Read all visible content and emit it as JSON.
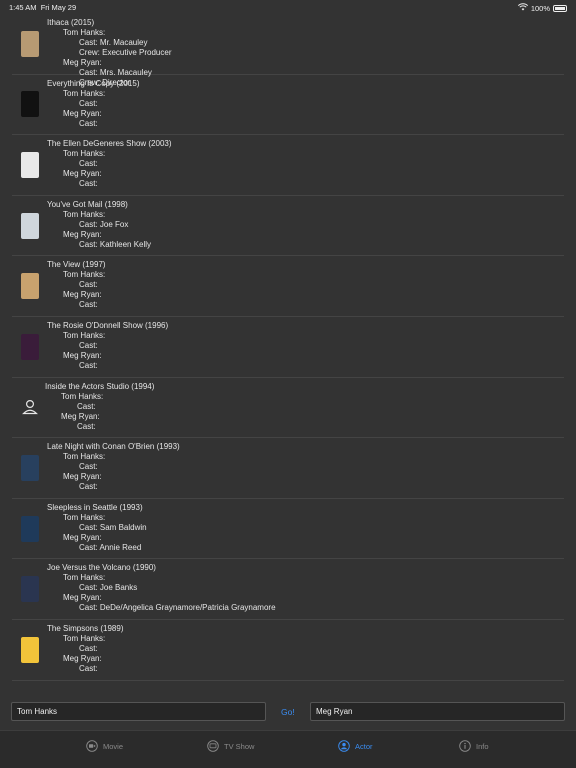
{
  "status": {
    "time": "1:45 AM",
    "date": "Fri May 29",
    "battery": "100%"
  },
  "movies": [
    {
      "title": "Ithaca (2015)",
      "a1": "Tom Hanks:",
      "r1": [
        "Cast: Mr. Macauley",
        "Crew: Executive Producer"
      ],
      "a2": "Meg Ryan:",
      "r2": [
        "Cast: Mrs. Macauley",
        "Crew: Director"
      ],
      "thumb": "#b79a73"
    },
    {
      "title": "Everything Is Copy (2015)",
      "a1": "Tom Hanks:",
      "r1": [
        "Cast:"
      ],
      "a2": "Meg Ryan:",
      "r2": [
        "Cast:"
      ],
      "thumb": "#111111"
    },
    {
      "title": "The Ellen DeGeneres Show (2003)",
      "a1": "Tom Hanks:",
      "r1": [
        "Cast:"
      ],
      "a2": "Meg Ryan:",
      "r2": [
        "Cast:"
      ],
      "thumb": "#e8e8e8"
    },
    {
      "title": "You've Got Mail (1998)",
      "a1": "Tom Hanks:",
      "r1": [
        "Cast: Joe Fox"
      ],
      "a2": "Meg Ryan:",
      "r2": [
        "Cast: Kathleen Kelly"
      ],
      "thumb": "#cfd6dc"
    },
    {
      "title": "The View (1997)",
      "a1": "Tom Hanks:",
      "r1": [
        "Cast:"
      ],
      "a2": "Meg Ryan:",
      "r2": [
        "Cast:"
      ],
      "thumb": "#c8a26e"
    },
    {
      "title": "The Rosie O'Donnell Show (1996)",
      "a1": "Tom Hanks:",
      "r1": [
        "Cast:"
      ],
      "a2": "Meg Ryan:",
      "r2": [
        "Cast:"
      ],
      "thumb": "#3a1c3a"
    },
    {
      "title": "Inside the Actors Studio (1994)",
      "a1": "Tom Hanks:",
      "r1": [
        "Cast:"
      ],
      "a2": "Meg Ryan:",
      "r2": [
        "Cast:"
      ],
      "thumb": "none"
    },
    {
      "title": "Late Night with Conan O'Brien (1993)",
      "a1": "Tom Hanks:",
      "r1": [
        "Cast:"
      ],
      "a2": "Meg Ryan:",
      "r2": [
        "Cast:"
      ],
      "thumb": "#28405e"
    },
    {
      "title": "Sleepless in Seattle (1993)",
      "a1": "Tom Hanks:",
      "r1": [
        "Cast: Sam Baldwin"
      ],
      "a2": "Meg Ryan:",
      "r2": [
        "Cast: Annie Reed"
      ],
      "thumb": "#1f3a5a"
    },
    {
      "title": "Joe Versus the Volcano (1990)",
      "a1": "Tom Hanks:",
      "r1": [
        "Cast: Joe Banks"
      ],
      "a2": "Meg Ryan:",
      "r2": [
        "Cast: DeDe/Angelica Graynamore/Patricia Graynamore"
      ],
      "thumb": "#2a3550"
    },
    {
      "title": "The Simpsons (1989)",
      "a1": "Tom Hanks:",
      "r1": [
        "Cast:"
      ],
      "a2": "Meg Ryan:",
      "r2": [
        "Cast:"
      ],
      "thumb": "#f2c43a"
    }
  ],
  "search": {
    "actor1": "Tom Hanks",
    "go": "Go!",
    "actor2": "Meg Ryan"
  },
  "tabs": [
    {
      "label": "Movie",
      "icon": "film-icon",
      "active": false
    },
    {
      "label": "TV Show",
      "icon": "tv-icon",
      "active": false
    },
    {
      "label": "Actor",
      "icon": "person-icon",
      "active": true
    },
    {
      "label": "Info",
      "icon": "info-icon",
      "active": false
    }
  ]
}
